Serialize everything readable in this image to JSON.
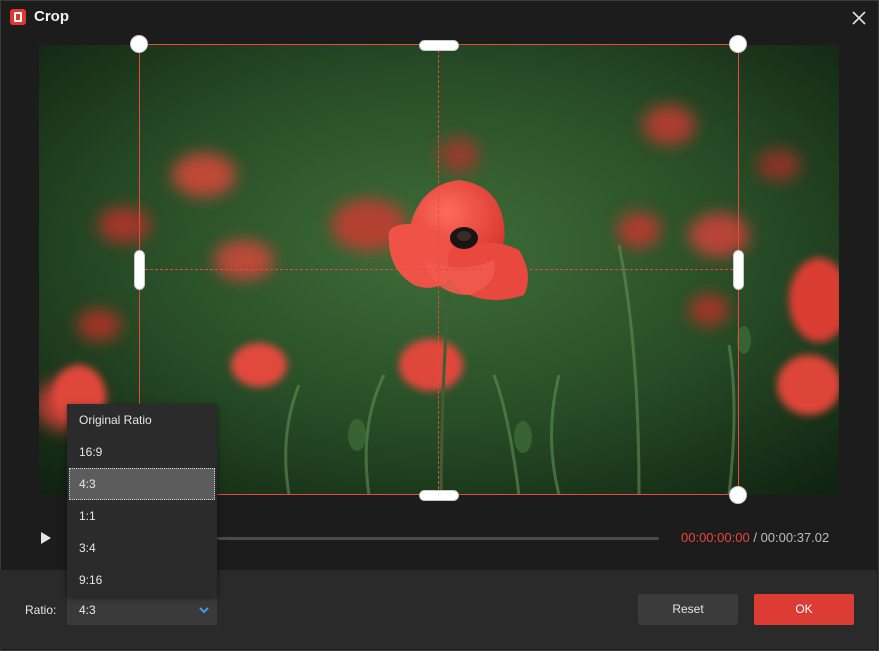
{
  "window": {
    "title": "Crop"
  },
  "icons": {
    "app": "app-logo-icon",
    "close": "close-icon",
    "play": "play-icon",
    "dropdown": "chevron-down-icon"
  },
  "player": {
    "current_time": "00:00:00:00",
    "separator": "/",
    "total_time": "00:00:37.02",
    "progress": 0
  },
  "ratio": {
    "label": "Ratio:",
    "selected": "4:3",
    "options": [
      "Original Ratio",
      "16:9",
      "4:3",
      "1:1",
      "3:4",
      "9:16"
    ]
  },
  "buttons": {
    "reset": "Reset",
    "ok": "OK"
  },
  "colors": {
    "accent": "#dc3c34",
    "crop_guide": "#e8483d",
    "time_current": "#e8483d"
  }
}
